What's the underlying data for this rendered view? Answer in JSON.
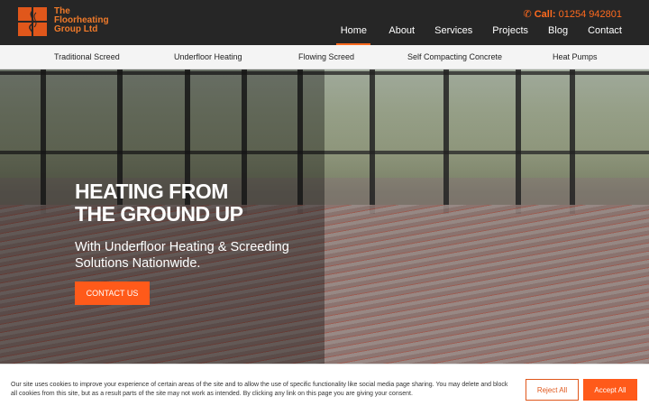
{
  "brand": {
    "name_line1": "The",
    "name_line2": "Floorheating",
    "name_line3": "Group Ltd"
  },
  "contact": {
    "call_label": "Call:",
    "phone": "01254 942801",
    "icon": "phone-icon"
  },
  "nav": {
    "items": [
      {
        "label": "Home",
        "active": true
      },
      {
        "label": "About"
      },
      {
        "label": "Services"
      },
      {
        "label": "Projects"
      },
      {
        "label": "Blog"
      },
      {
        "label": "Contact"
      }
    ]
  },
  "subnav": {
    "items": [
      {
        "label": "Traditional Screed"
      },
      {
        "label": "Underfloor Heating"
      },
      {
        "label": "Flowing Screed"
      },
      {
        "label": "Self Compacting Concrete"
      },
      {
        "label": "Heat Pumps"
      }
    ]
  },
  "hero": {
    "title_line1": "HEATING FROM",
    "title_line2": "THE GROUND UP",
    "subtitle": "With Underfloor Heating & Screeding Solutions Nationwide.",
    "cta_label": "CONTACT US"
  },
  "cookie": {
    "text": "Our site uses cookies to improve your experience of certain areas of the site and to allow the use of specific functionality like social media page sharing. You may delete and block all cookies from this site, but as a result parts of the site may not work as intended. By clicking any link on this page you are giving your consent.",
    "reject_label": "Reject All",
    "accept_label": "Accept All"
  },
  "colors": {
    "accent": "#ff5a1a",
    "header_bg": "#262626",
    "subnav_bg": "#f4f4f4"
  }
}
